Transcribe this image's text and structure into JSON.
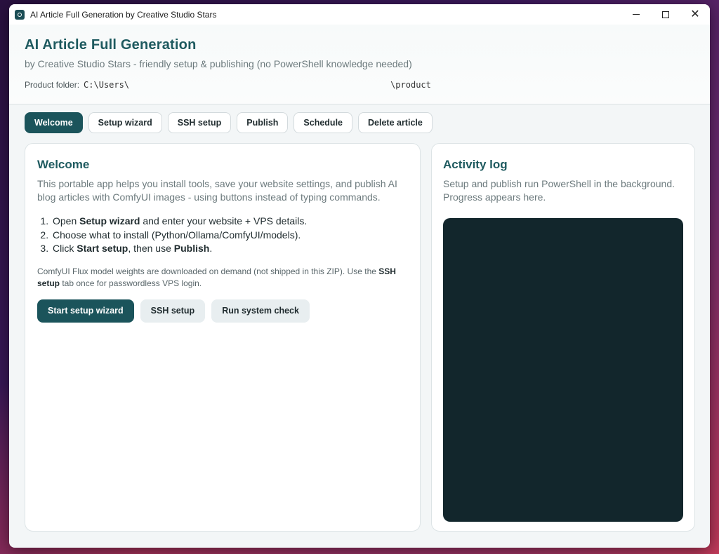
{
  "window": {
    "title": "AI Article Full Generation by Creative Studio Stars",
    "controls": {
      "minimize": "",
      "maximize": "",
      "close": "✕"
    }
  },
  "header": {
    "title": "AI Article Full Generation",
    "subtitle": "by Creative Studio Stars - friendly setup & publishing (no PowerShell knowledge needed)",
    "folder_label": "Product folder:",
    "folder_path": "C:\\Users\\",
    "folder_suffix": "\\product"
  },
  "tabs": [
    {
      "label": "Welcome",
      "active": true
    },
    {
      "label": "Setup wizard",
      "active": false
    },
    {
      "label": "SSH setup",
      "active": false
    },
    {
      "label": "Publish",
      "active": false
    },
    {
      "label": "Schedule",
      "active": false
    },
    {
      "label": "Delete article",
      "active": false
    }
  ],
  "welcome": {
    "title": "Welcome",
    "intro": "This portable app helps you install tools, save your website settings, and publish AI blog articles with ComfyUI images - using buttons instead of typing commands.",
    "steps": [
      {
        "pre": "Open ",
        "bold": "Setup wizard",
        "post": " and enter your website + VPS details."
      },
      {
        "pre": "Choose what to install (Python/Ollama/ComfyUI/models).",
        "bold": "",
        "post": ""
      },
      {
        "pre": "Click ",
        "bold": "Start setup",
        "mid": ", then use ",
        "bold2": "Publish",
        "post": "."
      }
    ],
    "note_pre": "ComfyUI Flux model weights are downloaded on demand (not shipped in this ZIP). Use the ",
    "note_bold": "SSH setup",
    "note_post": " tab once for passwordless VPS login.",
    "buttons": {
      "start": "Start setup wizard",
      "ssh": "SSH setup",
      "check": "Run system check"
    }
  },
  "log": {
    "title": "Activity log",
    "intro": "Setup and publish run PowerShell in the background. Progress appears here."
  },
  "colors": {
    "accent": "#1b545b",
    "heading": "#1e5a5f",
    "log_bg": "#12262c"
  }
}
